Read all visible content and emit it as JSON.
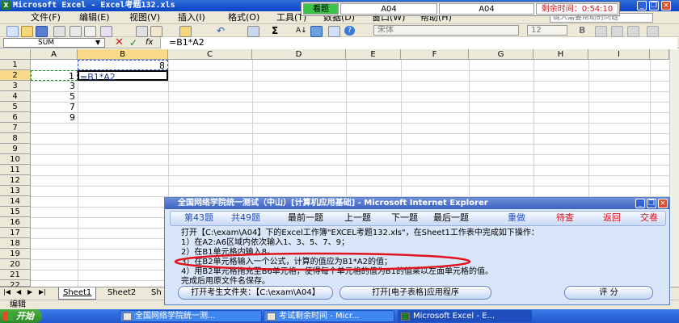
{
  "window": {
    "title": "Microsoft Excel - Excel考题132.xls"
  },
  "menu": [
    "文件(F)",
    "编辑(E)",
    "视图(V)",
    "插入(I)",
    "格式(O)",
    "工具(T)",
    "数据(D)",
    "窗口(W)",
    "帮助(H)"
  ],
  "help_box": {
    "placeholder": "键入需要帮助的问题"
  },
  "exam_bar": {
    "label": "看题",
    "left_id": "A04",
    "right_id": "A04",
    "timer": "剩余时间：0:54:10"
  },
  "font_box": {
    "font": "宋体",
    "size": "12"
  },
  "formula_bar": {
    "name_box": "SUM",
    "formula": "=B1*A2",
    "fx": "fx"
  },
  "columns": [
    "A",
    "B",
    "C",
    "D",
    "E",
    "F",
    "G",
    "H",
    "I"
  ],
  "rows": [
    "1",
    "2",
    "3",
    "4",
    "5",
    "6",
    "7",
    "8",
    "9",
    "10",
    "11",
    "12",
    "13",
    "14",
    "15",
    "16",
    "17",
    "18",
    "19",
    "20",
    "21",
    "22"
  ],
  "cells": {
    "B1": "8",
    "A2": "1",
    "B2": "=B1*A2",
    "A3": "3",
    "A4": "5",
    "A5": "7",
    "A6": "9"
  },
  "sheet_tabs": [
    "Sheet1",
    "Sheet2",
    "Sh"
  ],
  "status": "编辑",
  "taskbar": {
    "start": "开始",
    "tasks": [
      "全国网络学院统一测...",
      "考试剩余时间 - Micr...",
      "Microsoft Excel - E..."
    ]
  },
  "popup": {
    "title": "全国网络学院统一测试（中山）[计算机应用基础] - Microsoft Internet Explorer",
    "question_num": "第43题",
    "total": "共49题",
    "nav": [
      "最前一题",
      "上一题",
      "下一题",
      "最后一题",
      "重做",
      "待查",
      "返回",
      "交卷"
    ],
    "lines": [
      "打开【C:\\exam\\A04】下的Excel工作簿\"EXCEL考题132.xls\"，在Sheet1工作表中完成如下操作：",
      "1）在A2:A6区域内依次输入1、3、5、7、9；",
      "2）在B1单元格内输入8。",
      "3）在B2单元格输入一个公式，计算的值应为B1*A2的值；",
      "4）用B2单元格拖充至B6单元格，使得每个单元格的值为B1的值乘以左面单元格的值。",
      "完成后用原文件名保存。"
    ],
    "buttons": {
      "open_folder": "打开考生文件夹：【C:\\exam\\A04】",
      "open_app": "打开[电子表格]应用程序",
      "grade": "评 分"
    }
  },
  "colors": {
    "title_blue": "#0b43c4",
    "grid_line": "#d4d4d4",
    "highlight_red": "#e0141c",
    "popup_bg": "#d9e6fa",
    "nav_red": "#d4141c",
    "nav_blue": "#1f4fc0"
  }
}
